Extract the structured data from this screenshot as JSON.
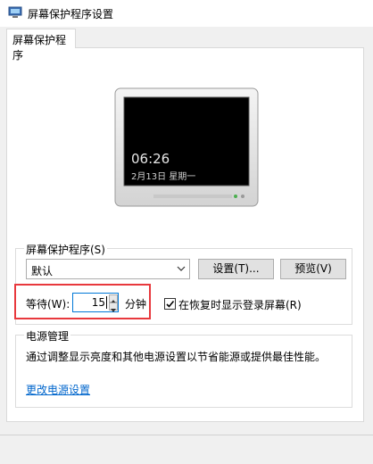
{
  "window": {
    "title": "屏幕保护程序设置",
    "icon": "screensaver-monitor-icon"
  },
  "tabs": [
    {
      "label": "屏幕保护程序"
    }
  ],
  "preview": {
    "time": "06:26",
    "date": "2月13日  星期一"
  },
  "screensaver": {
    "group_label": "屏幕保护程序(S)",
    "selected": "默认",
    "settings_button": "设置(T)...",
    "preview_button": "预览(V)",
    "wait_label": "等待(W):",
    "wait_value": "15",
    "wait_unit": "分钟",
    "resume_checkbox_label": "在恢复时显示登录屏幕(R)",
    "resume_checked": true
  },
  "power": {
    "group_label": "电源管理",
    "description": "通过调整显示亮度和其他电源设置以节省能源或提供最佳性能。",
    "link": "更改电源设置"
  },
  "colors": {
    "highlight": "#e8383d",
    "link": "#0066cc",
    "focus": "#0078d7"
  }
}
